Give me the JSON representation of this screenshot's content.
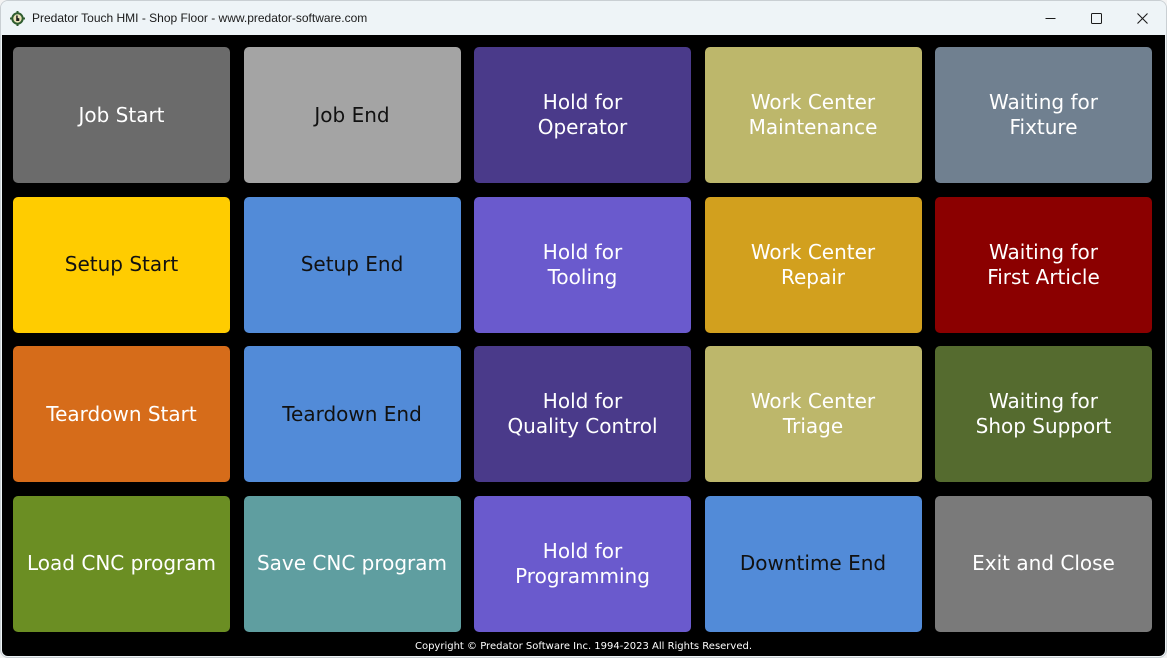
{
  "window": {
    "title": "Predator Touch HMI - Shop Floor - www.predator-software.com",
    "app_icon": "gear-hand-icon",
    "controls": {
      "minimize_icon": "minimize-icon",
      "maximize_icon": "maximize-icon",
      "close_icon": "close-icon"
    }
  },
  "tiles": [
    {
      "id": "job-start",
      "label": "Job Start",
      "bg": "#6b6b6b",
      "fg": "#ffffff"
    },
    {
      "id": "job-end",
      "label": "Job End",
      "bg": "#a4a4a4",
      "fg": "#111111"
    },
    {
      "id": "hold-for-operator",
      "label": "Hold for\nOperator",
      "bg": "#4a3a8a",
      "fg": "#ffffff"
    },
    {
      "id": "work-center-maintenance",
      "label": "Work Center\nMaintenance",
      "bg": "#bdb76b",
      "fg": "#ffffff"
    },
    {
      "id": "waiting-for-fixture",
      "label": "Waiting for\nFixture",
      "bg": "#708090",
      "fg": "#ffffff"
    },
    {
      "id": "setup-start",
      "label": "Setup Start",
      "bg": "#ffcc00",
      "fg": "#111111"
    },
    {
      "id": "setup-end",
      "label": "Setup End",
      "bg": "#528bd8",
      "fg": "#111111"
    },
    {
      "id": "hold-for-tooling",
      "label": "Hold for\nTooling",
      "bg": "#6a5acd",
      "fg": "#ffffff"
    },
    {
      "id": "work-center-repair",
      "label": "Work Center\nRepair",
      "bg": "#d2a01e",
      "fg": "#ffffff"
    },
    {
      "id": "waiting-for-first-article",
      "label": "Waiting for\nFirst Article",
      "bg": "#8b0000",
      "fg": "#ffffff"
    },
    {
      "id": "teardown-start",
      "label": "Teardown Start",
      "bg": "#d66c1a",
      "fg": "#ffffff"
    },
    {
      "id": "teardown-end",
      "label": "Teardown End",
      "bg": "#528bd8",
      "fg": "#111111"
    },
    {
      "id": "hold-for-quality-control",
      "label": "Hold for\nQuality Control",
      "bg": "#4a3a8a",
      "fg": "#ffffff"
    },
    {
      "id": "work-center-triage",
      "label": "Work Center\nTriage",
      "bg": "#bdb76b",
      "fg": "#ffffff"
    },
    {
      "id": "waiting-for-shop-support",
      "label": "Waiting for\nShop Support",
      "bg": "#556b2f",
      "fg": "#ffffff"
    },
    {
      "id": "load-cnc-program",
      "label": "Load CNC program",
      "bg": "#6b8e23",
      "fg": "#ffffff"
    },
    {
      "id": "save-cnc-program",
      "label": "Save CNC program",
      "bg": "#5f9ea0",
      "fg": "#ffffff"
    },
    {
      "id": "hold-for-programming",
      "label": "Hold for\nProgramming",
      "bg": "#6a5acd",
      "fg": "#ffffff"
    },
    {
      "id": "downtime-end",
      "label": "Downtime End",
      "bg": "#528bd8",
      "fg": "#111111"
    },
    {
      "id": "exit-and-close",
      "label": "Exit and Close",
      "bg": "#7a7a7a",
      "fg": "#ffffff"
    }
  ],
  "footer": {
    "copyright": "Copyright © Predator Software Inc. 1994-2023 All Rights Reserved."
  }
}
